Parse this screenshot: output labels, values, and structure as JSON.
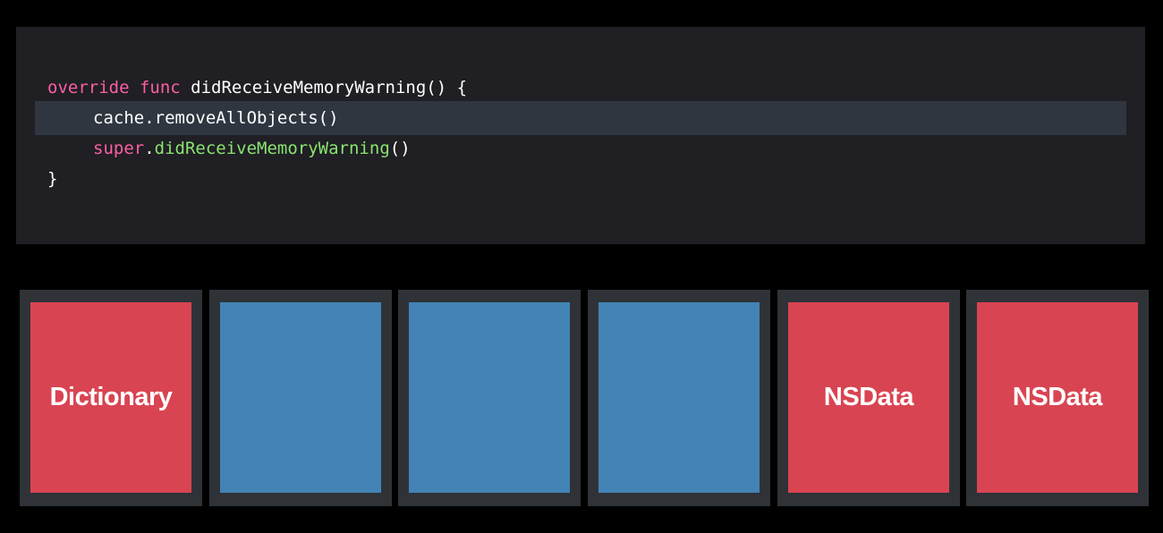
{
  "code": {
    "line1": {
      "keyword1": "override",
      "keyword2": "func",
      "rest": " didReceiveMemoryWarning() {"
    },
    "line2": {
      "text": "cache.removeAllObjects()"
    },
    "line3": {
      "keyword": "super",
      "dot": ".",
      "method": "didReceiveMemoryWarning",
      "rest": "()"
    },
    "line4": {
      "text": "}"
    }
  },
  "colors": {
    "keyword": "#fc5fa3",
    "method": "#8be36f",
    "red_block": "#d94452",
    "blue_block": "#4383b5",
    "slot_bg": "#2f3338",
    "highlight": "#2f3640"
  },
  "memory_blocks": [
    {
      "label": "Dictionary",
      "color": "red"
    },
    {
      "label": "",
      "color": "blue"
    },
    {
      "label": "",
      "color": "blue"
    },
    {
      "label": "",
      "color": "blue"
    },
    {
      "label": "NSData",
      "color": "red"
    },
    {
      "label": "NSData",
      "color": "red"
    }
  ]
}
